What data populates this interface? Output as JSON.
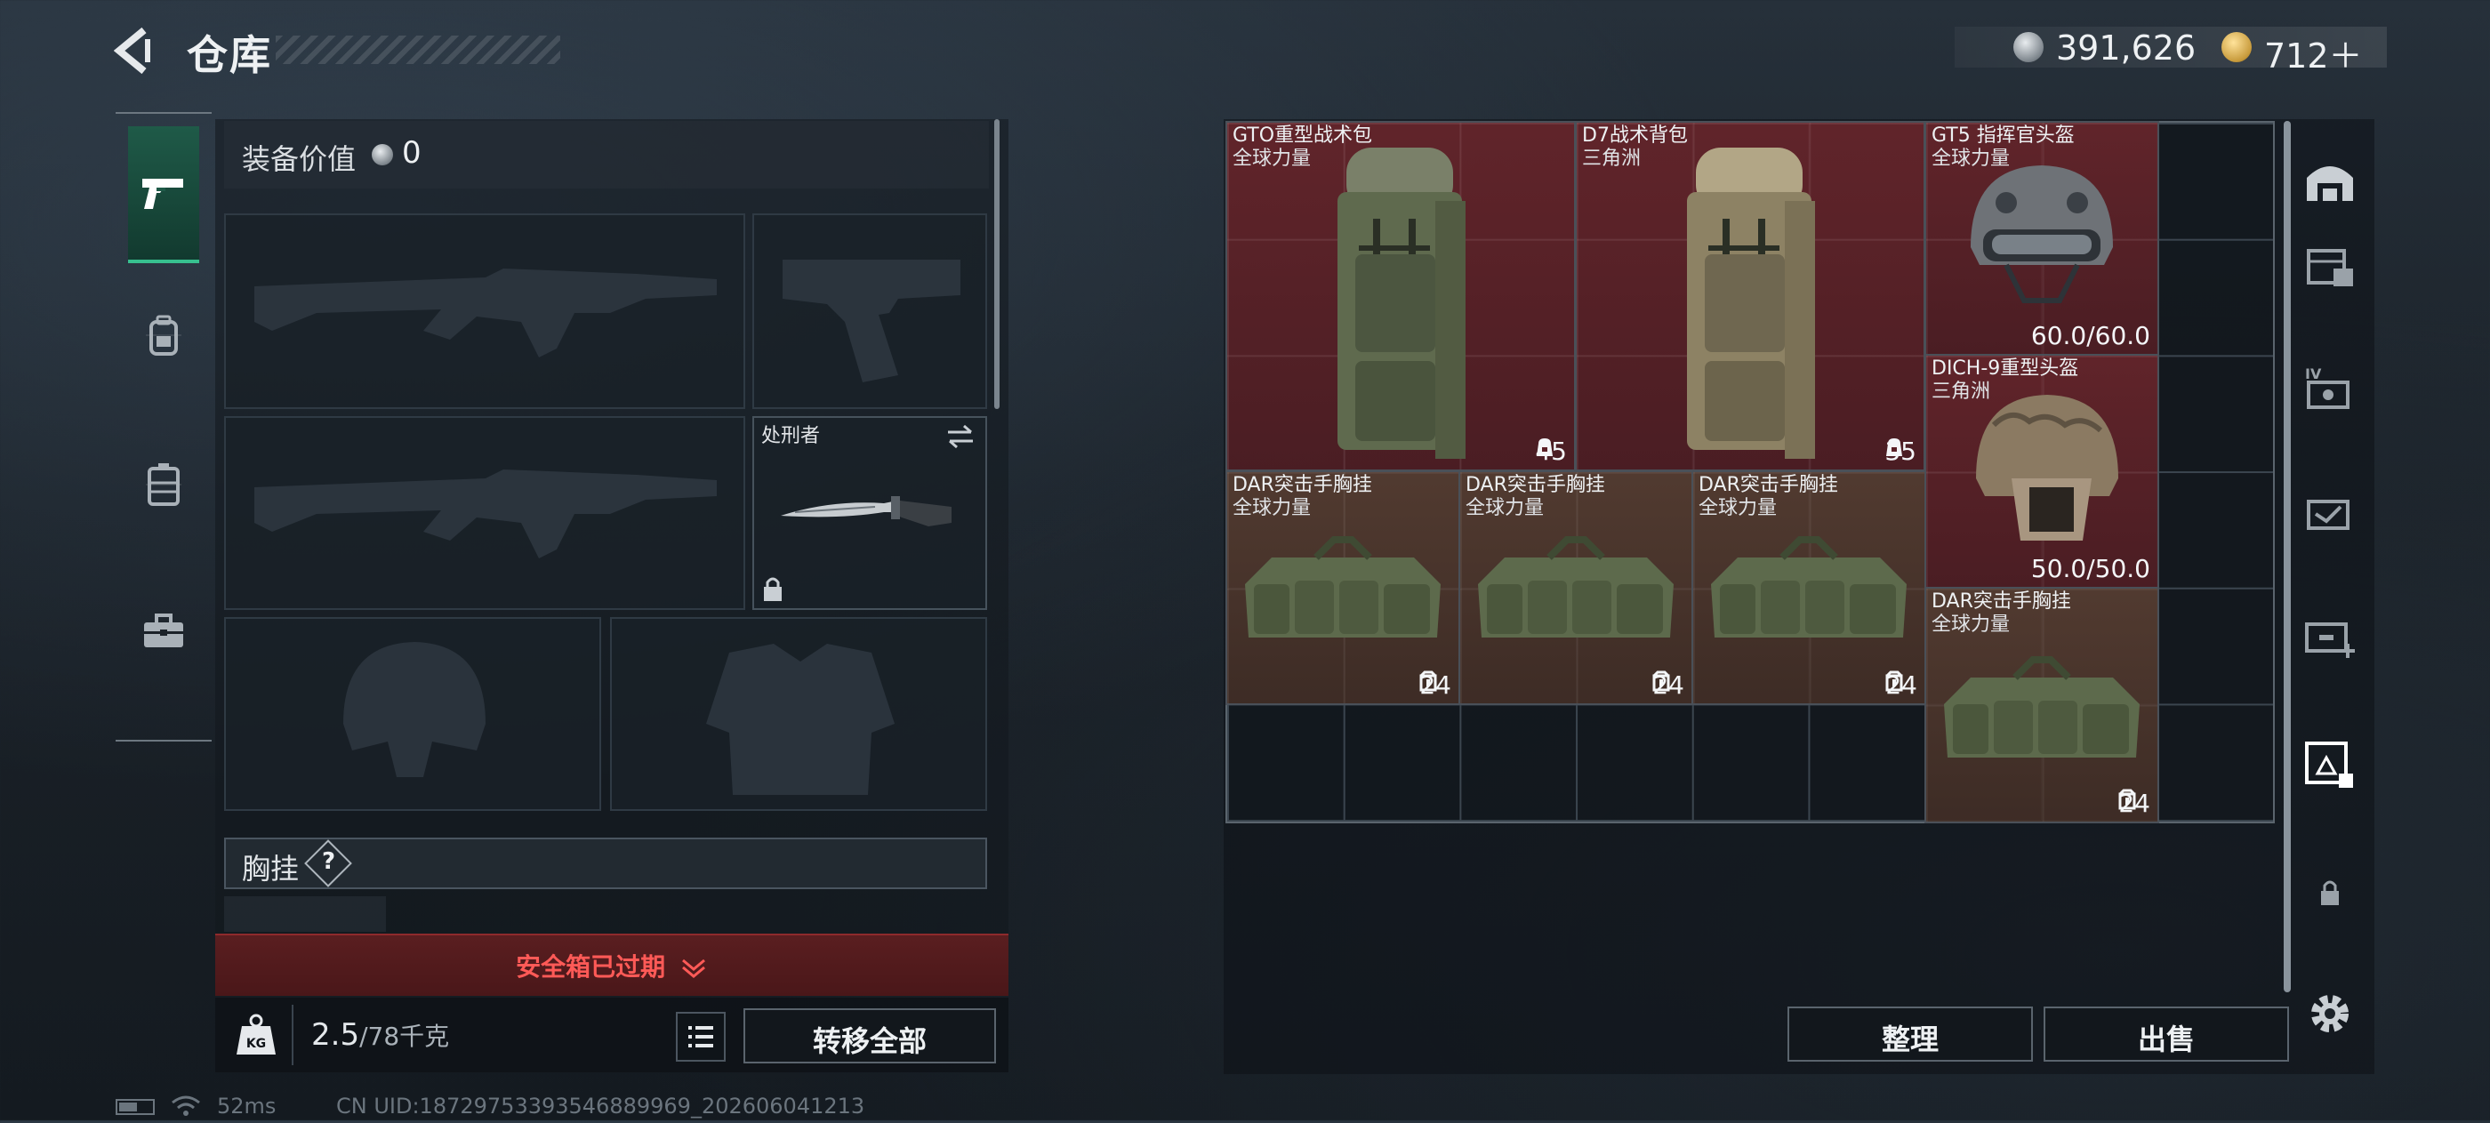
{
  "header": {
    "title": "仓库",
    "silver_value": "391,626",
    "gold_value": "712＋"
  },
  "left_tabs": [
    {
      "icon": "pistol-icon",
      "active": true
    },
    {
      "icon": "backpack-icon",
      "active": false
    },
    {
      "icon": "rig-icon",
      "active": false
    },
    {
      "icon": "briefcase-icon",
      "active": false
    }
  ],
  "loadout": {
    "value_label": "装备价值",
    "value_num": "0",
    "knife_name": "处刑者",
    "chest_label": "胸挂",
    "chest_help": "?",
    "safe_box_text": "安全箱已过期",
    "weight": "2.5",
    "weight_max": "/78千克",
    "transfer_all": "转移全部"
  },
  "stash_items": [
    {
      "name": "GTO重型战术包",
      "faction": "全球力量",
      "stat": "45",
      "stat_icon": "capacity-icon"
    },
    {
      "name": "D7战术背包",
      "faction": "三角洲",
      "stat": "35",
      "stat_icon": "capacity-icon"
    },
    {
      "name": "GT5 指挥官头盔",
      "faction": "全球力量",
      "stat": "60.0/60.0",
      "stat_icon": "durability"
    },
    {
      "name": "DICH-9重型头盔",
      "faction": "三角洲",
      "stat": "50.0/50.0",
      "stat_icon": "durability"
    },
    {
      "name": "DAR突击手胸挂",
      "faction": "全球力量",
      "stat": "24",
      "stat_icon": "rig-capacity-icon"
    },
    {
      "name": "DAR突击手胸挂",
      "faction": "全球力量",
      "stat": "24",
      "stat_icon": "rig-capacity-icon"
    },
    {
      "name": "DAR突击手胸挂",
      "faction": "全球力量",
      "stat": "24",
      "stat_icon": "rig-capacity-icon"
    },
    {
      "name": "DAR突击手胸挂",
      "faction": "全球力量",
      "stat": "24",
      "stat_icon": "rig-capacity-icon"
    }
  ],
  "stash_actions": {
    "organize": "整理",
    "sell": "出售"
  },
  "status": {
    "ping": "52ms",
    "uid": "CN UID:18729753393546889969_202606041213"
  },
  "colors": {
    "accent_green": "#37c08f",
    "danger_red": "#ff5a57",
    "rare_red": "#6e262c",
    "rare_brown": "#583e32"
  }
}
